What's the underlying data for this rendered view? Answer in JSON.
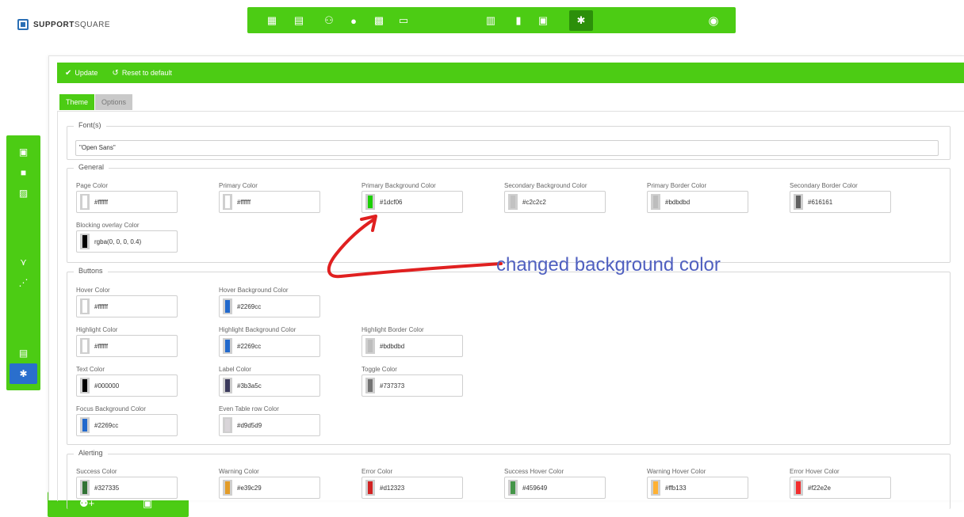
{
  "brand": {
    "name_bold": "SUPPORT",
    "name_thin": "SQUARE"
  },
  "toolbar": {
    "update_label": "Update",
    "reset_label": "Reset to default"
  },
  "tabs": [
    {
      "label": "Theme",
      "active": true
    },
    {
      "label": "Options",
      "active": false
    }
  ],
  "fonts": {
    "legend": "Font(s)",
    "value": "\"Open Sans\""
  },
  "general": {
    "legend": "General",
    "fields": [
      {
        "label": "Page Color",
        "value": "#ffffff",
        "swatch": "#ffffff"
      },
      {
        "label": "Primary Color",
        "value": "#ffffff",
        "swatch": "#ffffff"
      },
      {
        "label": "Primary Background Color",
        "value": "#1dcf06",
        "swatch": "#1dcf06"
      },
      {
        "label": "Secondary Background Color",
        "value": "#c2c2c2",
        "swatch": "#c2c2c2"
      },
      {
        "label": "Primary Border Color",
        "value": "#bdbdbd",
        "swatch": "#bdbdbd"
      },
      {
        "label": "Secondary Border Color",
        "value": "#616161",
        "swatch": "#616161"
      },
      {
        "label": "Blocking overlay Color",
        "value": "rgba(0, 0, 0, 0.4)",
        "swatch": "#000000"
      }
    ]
  },
  "buttons": {
    "legend": "Buttons",
    "fields": [
      {
        "label": "Hover Color",
        "value": "#ffffff",
        "swatch": "#ffffff"
      },
      {
        "label": "Hover Background Color",
        "value": "#2269cc",
        "swatch": "#2269cc"
      },
      {
        "label": "Highlight Color",
        "value": "#ffffff",
        "swatch": "#ffffff"
      },
      {
        "label": "Highlight Background Color",
        "value": "#2269cc",
        "swatch": "#2269cc"
      },
      {
        "label": "Highlight Border Color",
        "value": "#bdbdbd",
        "swatch": "#bdbdbd"
      },
      {
        "label": "Text Color",
        "value": "#000000",
        "swatch": "#000000"
      },
      {
        "label": "Label Color",
        "value": "#3b3a5c",
        "swatch": "#3b3a5c"
      },
      {
        "label": "Toggle Color",
        "value": "#737373",
        "swatch": "#737373"
      },
      {
        "label": "Focus Background Color",
        "value": "#2269cc",
        "swatch": "#2269cc"
      },
      {
        "label": "Even Table row Color",
        "value": "#d9d5d9",
        "swatch": "#d9d5d9"
      }
    ]
  },
  "alerting": {
    "legend": "Alerting",
    "fields": [
      {
        "label": "Success Color",
        "value": "#327335",
        "swatch": "#327335"
      },
      {
        "label": "Warning Color",
        "value": "#e39c29",
        "swatch": "#e39c29"
      },
      {
        "label": "Error Color",
        "value": "#d12323",
        "swatch": "#d12323"
      },
      {
        "label": "Success Hover Color",
        "value": "#459649",
        "swatch": "#459649"
      },
      {
        "label": "Warning Hover Color",
        "value": "#ffb133",
        "swatch": "#ffb133"
      },
      {
        "label": "Error Hover Color",
        "value": "#f22e2e",
        "swatch": "#f22e2e"
      }
    ]
  },
  "annotation": {
    "text": "changed background color",
    "color": "#5060c0",
    "arrow_color": "#e02020"
  },
  "colors": {
    "accent": "#4ccc14",
    "active_nav": "#2a6fcd"
  }
}
